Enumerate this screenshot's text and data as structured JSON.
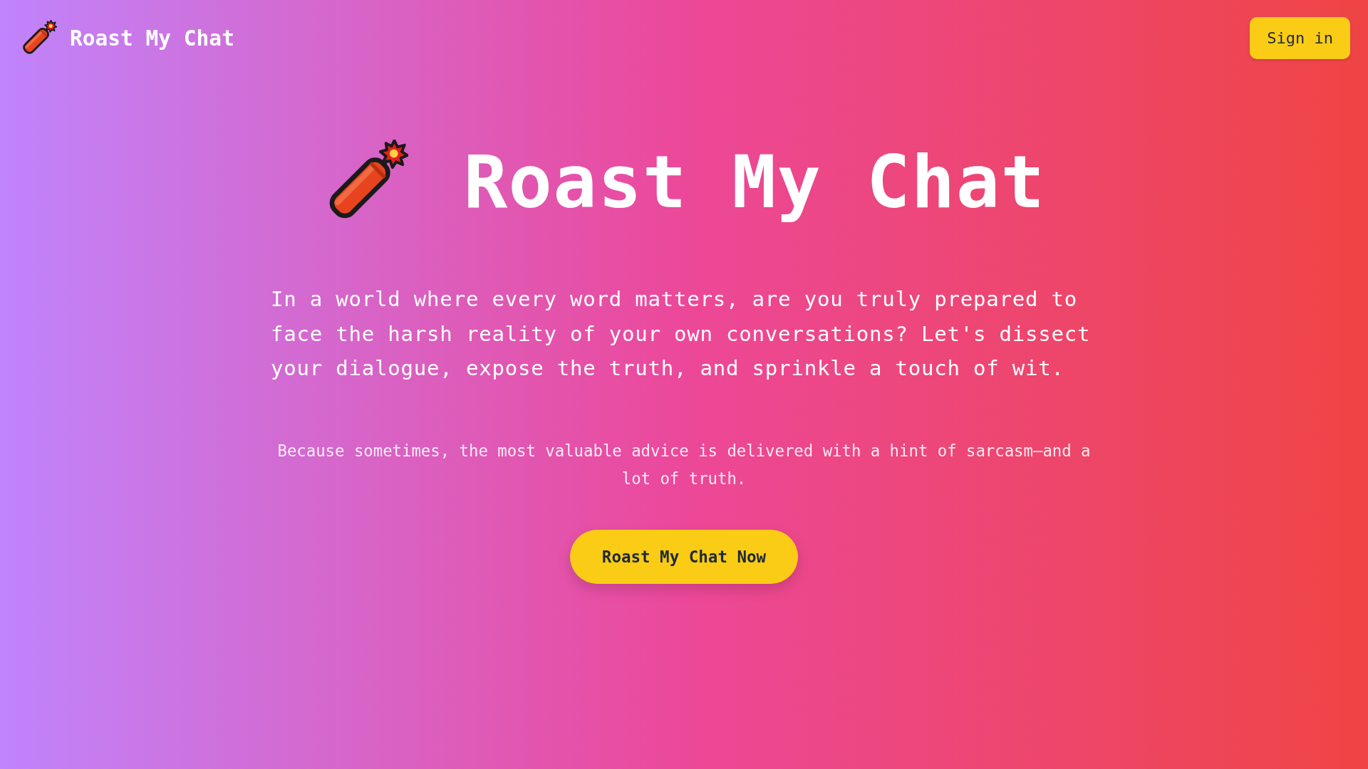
{
  "header": {
    "logo_text": "Roast My Chat",
    "sign_in_button": "Sign in"
  },
  "hero": {
    "title": "Roast My Chat",
    "intro": "In a world where every word matters, are you truly prepared to face the harsh reality of your own conversations? Let's dissect your dialogue, expose the truth, and sprinkle a touch of wit.",
    "tagline": "Because sometimes, the most valuable advice is delivered with a hint of sarcasm—and a lot of truth.",
    "cta_button": "Roast My Chat Now"
  }
}
